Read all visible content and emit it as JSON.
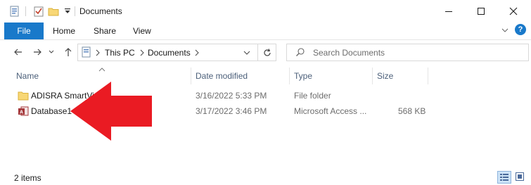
{
  "window": {
    "title": "Documents"
  },
  "ribbon": {
    "tabs": [
      "File",
      "Home",
      "Share",
      "View"
    ]
  },
  "address": {
    "breadcrumbs": [
      "This PC",
      "Documents"
    ]
  },
  "search": {
    "placeholder": "Search Documents"
  },
  "columns": {
    "name": "Name",
    "date_modified": "Date modified",
    "type": "Type",
    "size": "Size"
  },
  "files": [
    {
      "name": "ADISRA SmartVie",
      "date_modified": "3/16/2022 5:33 PM",
      "type": "File folder",
      "size": "",
      "icon": "folder-icon"
    },
    {
      "name": "Database1",
      "date_modified": "3/17/2022 3:46 PM",
      "type": "Microsoft Access ...",
      "size": "568 KB",
      "icon": "access-file-icon"
    }
  ],
  "status": {
    "item_count": "2 items"
  },
  "colors": {
    "accent": "#1979ca",
    "folder": "#f8d775",
    "arrow": "#ea1b23",
    "access": "#a4373a"
  }
}
